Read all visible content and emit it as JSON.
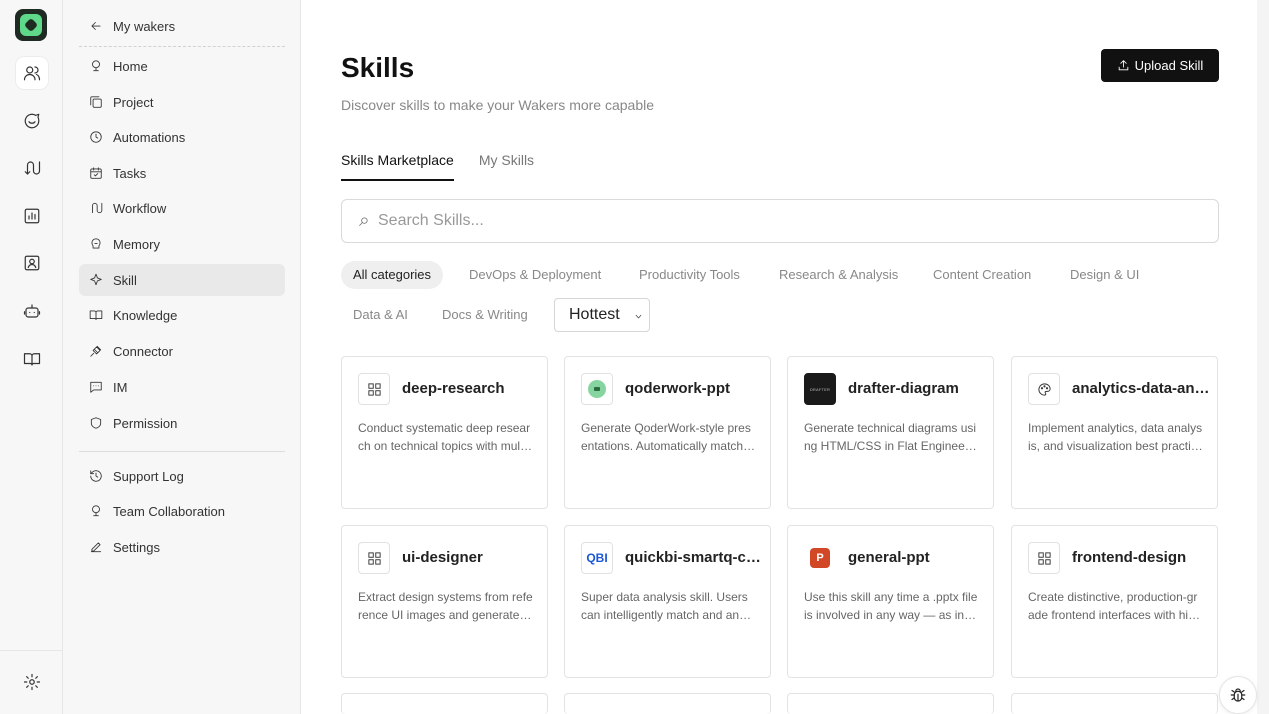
{
  "sidebar": {
    "back_label": "My wakers",
    "items": [
      {
        "label": "Home",
        "icon": "home-icon"
      },
      {
        "label": "Project",
        "icon": "project-icon"
      },
      {
        "label": "Automations",
        "icon": "clock-icon"
      },
      {
        "label": "Tasks",
        "icon": "calendar-icon"
      },
      {
        "label": "Workflow",
        "icon": "workflow-icon"
      },
      {
        "label": "Memory",
        "icon": "memory-icon"
      },
      {
        "label": "Skill",
        "icon": "skill-icon"
      },
      {
        "label": "Knowledge",
        "icon": "book-icon"
      },
      {
        "label": "Connector",
        "icon": "plug-icon"
      },
      {
        "label": "IM",
        "icon": "chat-icon"
      },
      {
        "label": "Permission",
        "icon": "shield-icon"
      }
    ],
    "bottom_items": [
      {
        "label": "Support Log",
        "icon": "history-icon"
      },
      {
        "label": "Team Collaboration",
        "icon": "team-icon"
      },
      {
        "label": "Settings",
        "icon": "edit-icon"
      }
    ],
    "active": "Skill"
  },
  "header": {
    "title": "Skills",
    "subtitle": "Discover skills to make your Wakers more capable",
    "upload_label": "Upload Skill"
  },
  "tabs": [
    {
      "label": "Skills Marketplace",
      "active": true
    },
    {
      "label": "My Skills",
      "active": false
    }
  ],
  "search": {
    "placeholder": "Search Skills...",
    "value": ""
  },
  "categories": [
    "All categories",
    "DevOps & Deployment",
    "Productivity Tools",
    "Research & Analysis",
    "Content Creation",
    "Design & UI",
    "Data & AI",
    "Docs & Writing"
  ],
  "active_category": "All categories",
  "sort": {
    "selected": "Hottest"
  },
  "skills": [
    {
      "name": "deep-research",
      "desc": "Conduct systematic deep research on technical topics with multiple sources",
      "icon": "grid-icon"
    },
    {
      "name": "qoderwork-ppt",
      "desc": "Generate QoderWork-style presentations. Automatically matches layouts",
      "icon": "qoder-icon"
    },
    {
      "name": "drafter-diagram",
      "desc": "Generate technical diagrams using HTML/CSS in Flat Engineering style",
      "icon": "drafter-icon",
      "icon_text": "DRAFTER"
    },
    {
      "name": "analytics-data-analysis",
      "desc": "Implement analytics, data analysis, and visualization best practices",
      "icon": "palette-icon"
    },
    {
      "name": "ui-designer",
      "desc": "Extract design systems from reference UI images and generate code",
      "icon": "grid-icon"
    },
    {
      "name": "quickbi-smartq-chat",
      "desc": "Super data analysis skill. Users can intelligently match and analyze data",
      "icon": "qbi-icon",
      "icon_text": "QBI"
    },
    {
      "name": "general-ppt",
      "desc": "Use this skill any time a .pptx file is involved in any way — as input or output",
      "icon": "powerpoint-icon",
      "icon_text": "P"
    },
    {
      "name": "frontend-design",
      "desc": "Create distinctive, production-grade frontend interfaces with high design quality",
      "icon": "grid-icon"
    }
  ],
  "colors": {
    "accent": "#111111",
    "active_bg": "#e9e9e9",
    "logo": "#5fd88a"
  }
}
